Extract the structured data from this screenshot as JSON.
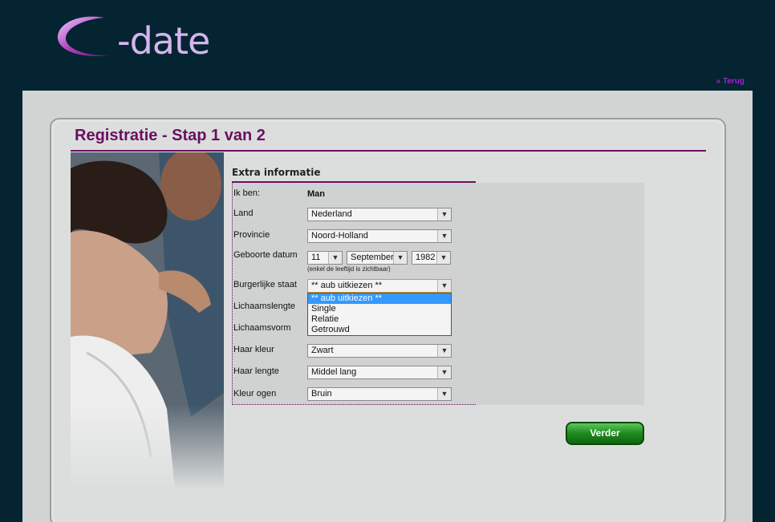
{
  "brand": {
    "logo_text": "-date"
  },
  "nav": {
    "back_label": "» Terug"
  },
  "page": {
    "title": "Registratie - Stap 1 van 2"
  },
  "section": {
    "title": "Extra informatie"
  },
  "form": {
    "gender_label": "Ik ben:",
    "gender_value": "Man",
    "country_label": "Land",
    "country_value": "Nederland",
    "province_label": "Provincie",
    "province_value": "Noord-Holland",
    "birthdate_label": "Geboorte datum",
    "birth_day": "11",
    "birth_month": "September",
    "birth_year": "1982",
    "birthdate_hint": "(enkel de leeftijd is zichtbaar)",
    "marital_label": "Burgerlijke staat",
    "marital_value": "** aub uitkiezen **",
    "height_label": "Lichaamslengte",
    "body_label": "Lichaamsvorm",
    "hair_color_label": "Haar kleur",
    "hair_color_value": "Zwart",
    "hair_length_label": "Haar lengte",
    "hair_length_value": "Middel lang",
    "eye_color_label": "Kleur ogen",
    "eye_color_value": "Bruin"
  },
  "marital_options": [
    "** aub uitkiezen **",
    "Single",
    "Relatie",
    "Getrouwd"
  ],
  "submit": {
    "label": "Verder"
  },
  "colors": {
    "background": "#032430",
    "accent": "#6a1060",
    "link": "#a020d0",
    "button": "#1e8a1e",
    "highlight": "#3399ff"
  }
}
